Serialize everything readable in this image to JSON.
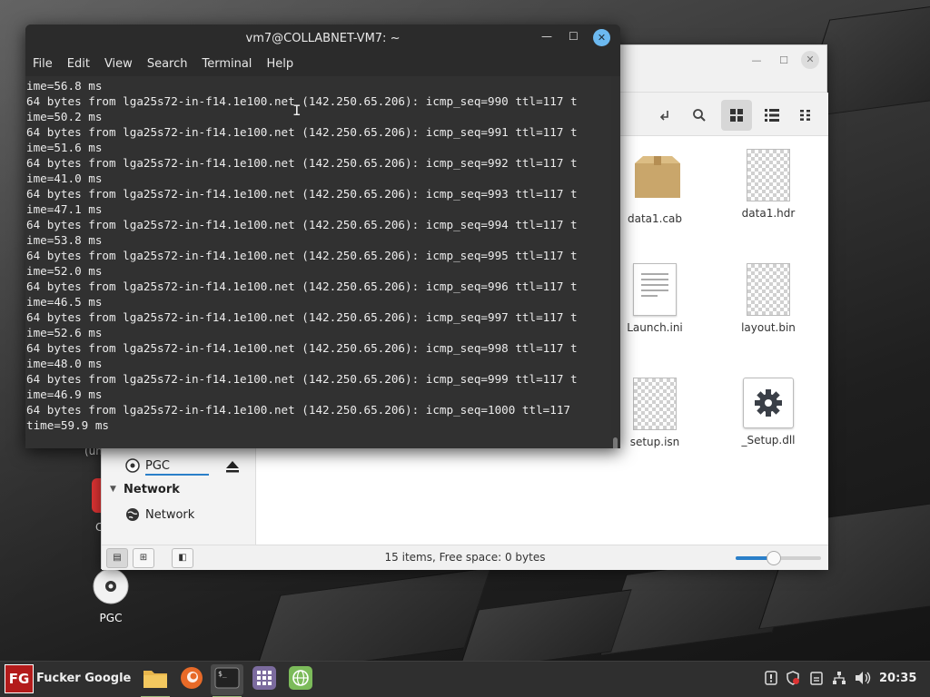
{
  "desktop": {
    "icons": [
      {
        "label": "PGC"
      }
    ],
    "partial_labels": {
      "left1": "(un",
      "left2": "C"
    }
  },
  "terminal": {
    "title": "vm7@COLLABNET-VM7: ~",
    "menu": [
      "File",
      "Edit",
      "View",
      "Search",
      "Terminal",
      "Help"
    ],
    "lines": [
      "ime=56.8 ms",
      "64 bytes from lga25s72-in-f14.1e100.net (142.250.65.206): icmp_seq=990 ttl=117 t",
      "ime=50.2 ms",
      "64 bytes from lga25s72-in-f14.1e100.net (142.250.65.206): icmp_seq=991 ttl=117 t",
      "ime=51.6 ms",
      "64 bytes from lga25s72-in-f14.1e100.net (142.250.65.206): icmp_seq=992 ttl=117 t",
      "ime=41.0 ms",
      "64 bytes from lga25s72-in-f14.1e100.net (142.250.65.206): icmp_seq=993 ttl=117 t",
      "ime=47.1 ms",
      "64 bytes from lga25s72-in-f14.1e100.net (142.250.65.206): icmp_seq=994 ttl=117 t",
      "ime=53.8 ms",
      "64 bytes from lga25s72-in-f14.1e100.net (142.250.65.206): icmp_seq=995 ttl=117 t",
      "ime=52.0 ms",
      "64 bytes from lga25s72-in-f14.1e100.net (142.250.65.206): icmp_seq=996 ttl=117 t",
      "ime=46.5 ms",
      "64 bytes from lga25s72-in-f14.1e100.net (142.250.65.206): icmp_seq=997 ttl=117 t",
      "ime=52.6 ms",
      "64 bytes from lga25s72-in-f14.1e100.net (142.250.65.206): icmp_seq=998 ttl=117 t",
      "ime=48.0 ms",
      "64 bytes from lga25s72-in-f14.1e100.net (142.250.65.206): icmp_seq=999 ttl=117 t",
      "ime=46.9 ms",
      "64 bytes from lga25s72-in-f14.1e100.net (142.250.65.206): icmp_seq=1000 ttl=117",
      "time=59.9 ms"
    ]
  },
  "file_manager": {
    "files": [
      {
        "name": "data1.cab",
        "icon": "package-icon"
      },
      {
        "name": "data1.hdr",
        "icon": "generic-file-icon"
      },
      {
        "name": "Launch.ini",
        "icon": "text-file-icon"
      },
      {
        "name": "layout.bin",
        "icon": "generic-file-icon"
      },
      {
        "name": "setup.isn",
        "icon": "generic-file-icon"
      },
      {
        "name": "_Setup.dll",
        "icon": "gear-file-icon"
      }
    ],
    "sidebar": {
      "pgc_label": "PGC",
      "network_header": "Network",
      "network_item": "Network"
    },
    "status_text": "15 items, Free space: 0 bytes",
    "zoom_level": 0.45
  },
  "taskbar": {
    "start_label": "Fucker Google",
    "clock": "20:35",
    "accent": "#9ab87a"
  }
}
